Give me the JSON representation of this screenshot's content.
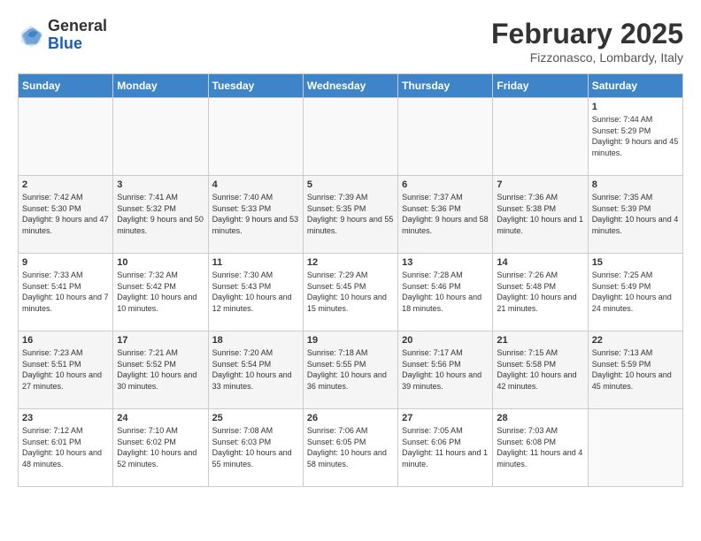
{
  "header": {
    "logo_general": "General",
    "logo_blue": "Blue",
    "title": "February 2025",
    "location": "Fizzonasco, Lombardy, Italy"
  },
  "days_of_week": [
    "Sunday",
    "Monday",
    "Tuesday",
    "Wednesday",
    "Thursday",
    "Friday",
    "Saturday"
  ],
  "weeks": [
    {
      "days": [
        {
          "num": "",
          "info": ""
        },
        {
          "num": "",
          "info": ""
        },
        {
          "num": "",
          "info": ""
        },
        {
          "num": "",
          "info": ""
        },
        {
          "num": "",
          "info": ""
        },
        {
          "num": "",
          "info": ""
        },
        {
          "num": "1",
          "info": "Sunrise: 7:44 AM\nSunset: 5:29 PM\nDaylight: 9 hours and 45 minutes."
        }
      ]
    },
    {
      "days": [
        {
          "num": "2",
          "info": "Sunrise: 7:42 AM\nSunset: 5:30 PM\nDaylight: 9 hours and 47 minutes."
        },
        {
          "num": "3",
          "info": "Sunrise: 7:41 AM\nSunset: 5:32 PM\nDaylight: 9 hours and 50 minutes."
        },
        {
          "num": "4",
          "info": "Sunrise: 7:40 AM\nSunset: 5:33 PM\nDaylight: 9 hours and 53 minutes."
        },
        {
          "num": "5",
          "info": "Sunrise: 7:39 AM\nSunset: 5:35 PM\nDaylight: 9 hours and 55 minutes."
        },
        {
          "num": "6",
          "info": "Sunrise: 7:37 AM\nSunset: 5:36 PM\nDaylight: 9 hours and 58 minutes."
        },
        {
          "num": "7",
          "info": "Sunrise: 7:36 AM\nSunset: 5:38 PM\nDaylight: 10 hours and 1 minute."
        },
        {
          "num": "8",
          "info": "Sunrise: 7:35 AM\nSunset: 5:39 PM\nDaylight: 10 hours and 4 minutes."
        }
      ]
    },
    {
      "days": [
        {
          "num": "9",
          "info": "Sunrise: 7:33 AM\nSunset: 5:41 PM\nDaylight: 10 hours and 7 minutes."
        },
        {
          "num": "10",
          "info": "Sunrise: 7:32 AM\nSunset: 5:42 PM\nDaylight: 10 hours and 10 minutes."
        },
        {
          "num": "11",
          "info": "Sunrise: 7:30 AM\nSunset: 5:43 PM\nDaylight: 10 hours and 12 minutes."
        },
        {
          "num": "12",
          "info": "Sunrise: 7:29 AM\nSunset: 5:45 PM\nDaylight: 10 hours and 15 minutes."
        },
        {
          "num": "13",
          "info": "Sunrise: 7:28 AM\nSunset: 5:46 PM\nDaylight: 10 hours and 18 minutes."
        },
        {
          "num": "14",
          "info": "Sunrise: 7:26 AM\nSunset: 5:48 PM\nDaylight: 10 hours and 21 minutes."
        },
        {
          "num": "15",
          "info": "Sunrise: 7:25 AM\nSunset: 5:49 PM\nDaylight: 10 hours and 24 minutes."
        }
      ]
    },
    {
      "days": [
        {
          "num": "16",
          "info": "Sunrise: 7:23 AM\nSunset: 5:51 PM\nDaylight: 10 hours and 27 minutes."
        },
        {
          "num": "17",
          "info": "Sunrise: 7:21 AM\nSunset: 5:52 PM\nDaylight: 10 hours and 30 minutes."
        },
        {
          "num": "18",
          "info": "Sunrise: 7:20 AM\nSunset: 5:54 PM\nDaylight: 10 hours and 33 minutes."
        },
        {
          "num": "19",
          "info": "Sunrise: 7:18 AM\nSunset: 5:55 PM\nDaylight: 10 hours and 36 minutes."
        },
        {
          "num": "20",
          "info": "Sunrise: 7:17 AM\nSunset: 5:56 PM\nDaylight: 10 hours and 39 minutes."
        },
        {
          "num": "21",
          "info": "Sunrise: 7:15 AM\nSunset: 5:58 PM\nDaylight: 10 hours and 42 minutes."
        },
        {
          "num": "22",
          "info": "Sunrise: 7:13 AM\nSunset: 5:59 PM\nDaylight: 10 hours and 45 minutes."
        }
      ]
    },
    {
      "days": [
        {
          "num": "23",
          "info": "Sunrise: 7:12 AM\nSunset: 6:01 PM\nDaylight: 10 hours and 48 minutes."
        },
        {
          "num": "24",
          "info": "Sunrise: 7:10 AM\nSunset: 6:02 PM\nDaylight: 10 hours and 52 minutes."
        },
        {
          "num": "25",
          "info": "Sunrise: 7:08 AM\nSunset: 6:03 PM\nDaylight: 10 hours and 55 minutes."
        },
        {
          "num": "26",
          "info": "Sunrise: 7:06 AM\nSunset: 6:05 PM\nDaylight: 10 hours and 58 minutes."
        },
        {
          "num": "27",
          "info": "Sunrise: 7:05 AM\nSunset: 6:06 PM\nDaylight: 11 hours and 1 minute."
        },
        {
          "num": "28",
          "info": "Sunrise: 7:03 AM\nSunset: 6:08 PM\nDaylight: 11 hours and 4 minutes."
        },
        {
          "num": "",
          "info": ""
        }
      ]
    }
  ]
}
